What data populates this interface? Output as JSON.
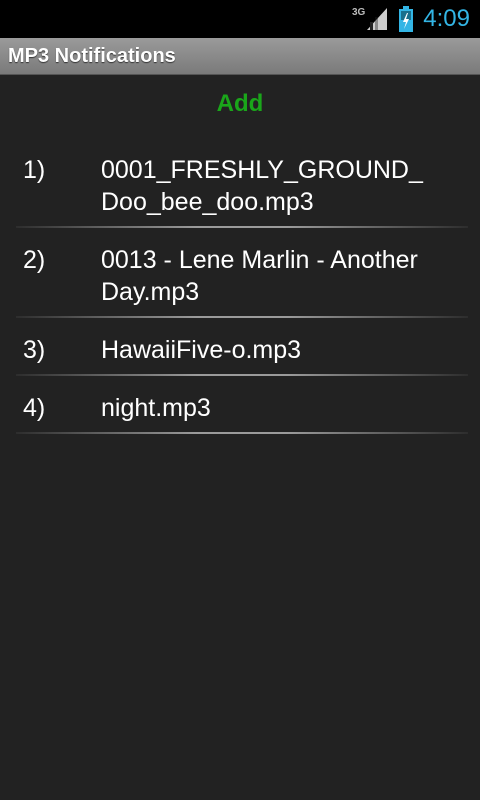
{
  "status_bar": {
    "network_type": "3G",
    "time": "4:09",
    "icons": [
      "signal-icon",
      "battery-charging-icon"
    ]
  },
  "app": {
    "title": "MP3 Notifications"
  },
  "actions": {
    "add_label": "Add",
    "add_color": "#1aa61a"
  },
  "list": {
    "items": [
      {
        "index": "1)",
        "name": "0001_FRESHLY_GROUND_\nDoo_bee_doo.mp3"
      },
      {
        "index": "2)",
        "name": "0013 - Lene Marlin - Another Day.mp3"
      },
      {
        "index": "3)",
        "name": "HawaiiFive-o.mp3"
      },
      {
        "index": "4)",
        "name": "night.mp3"
      }
    ]
  },
  "colors": {
    "background": "#222222",
    "clock": "#33b5e5",
    "text": "#ffffff"
  }
}
